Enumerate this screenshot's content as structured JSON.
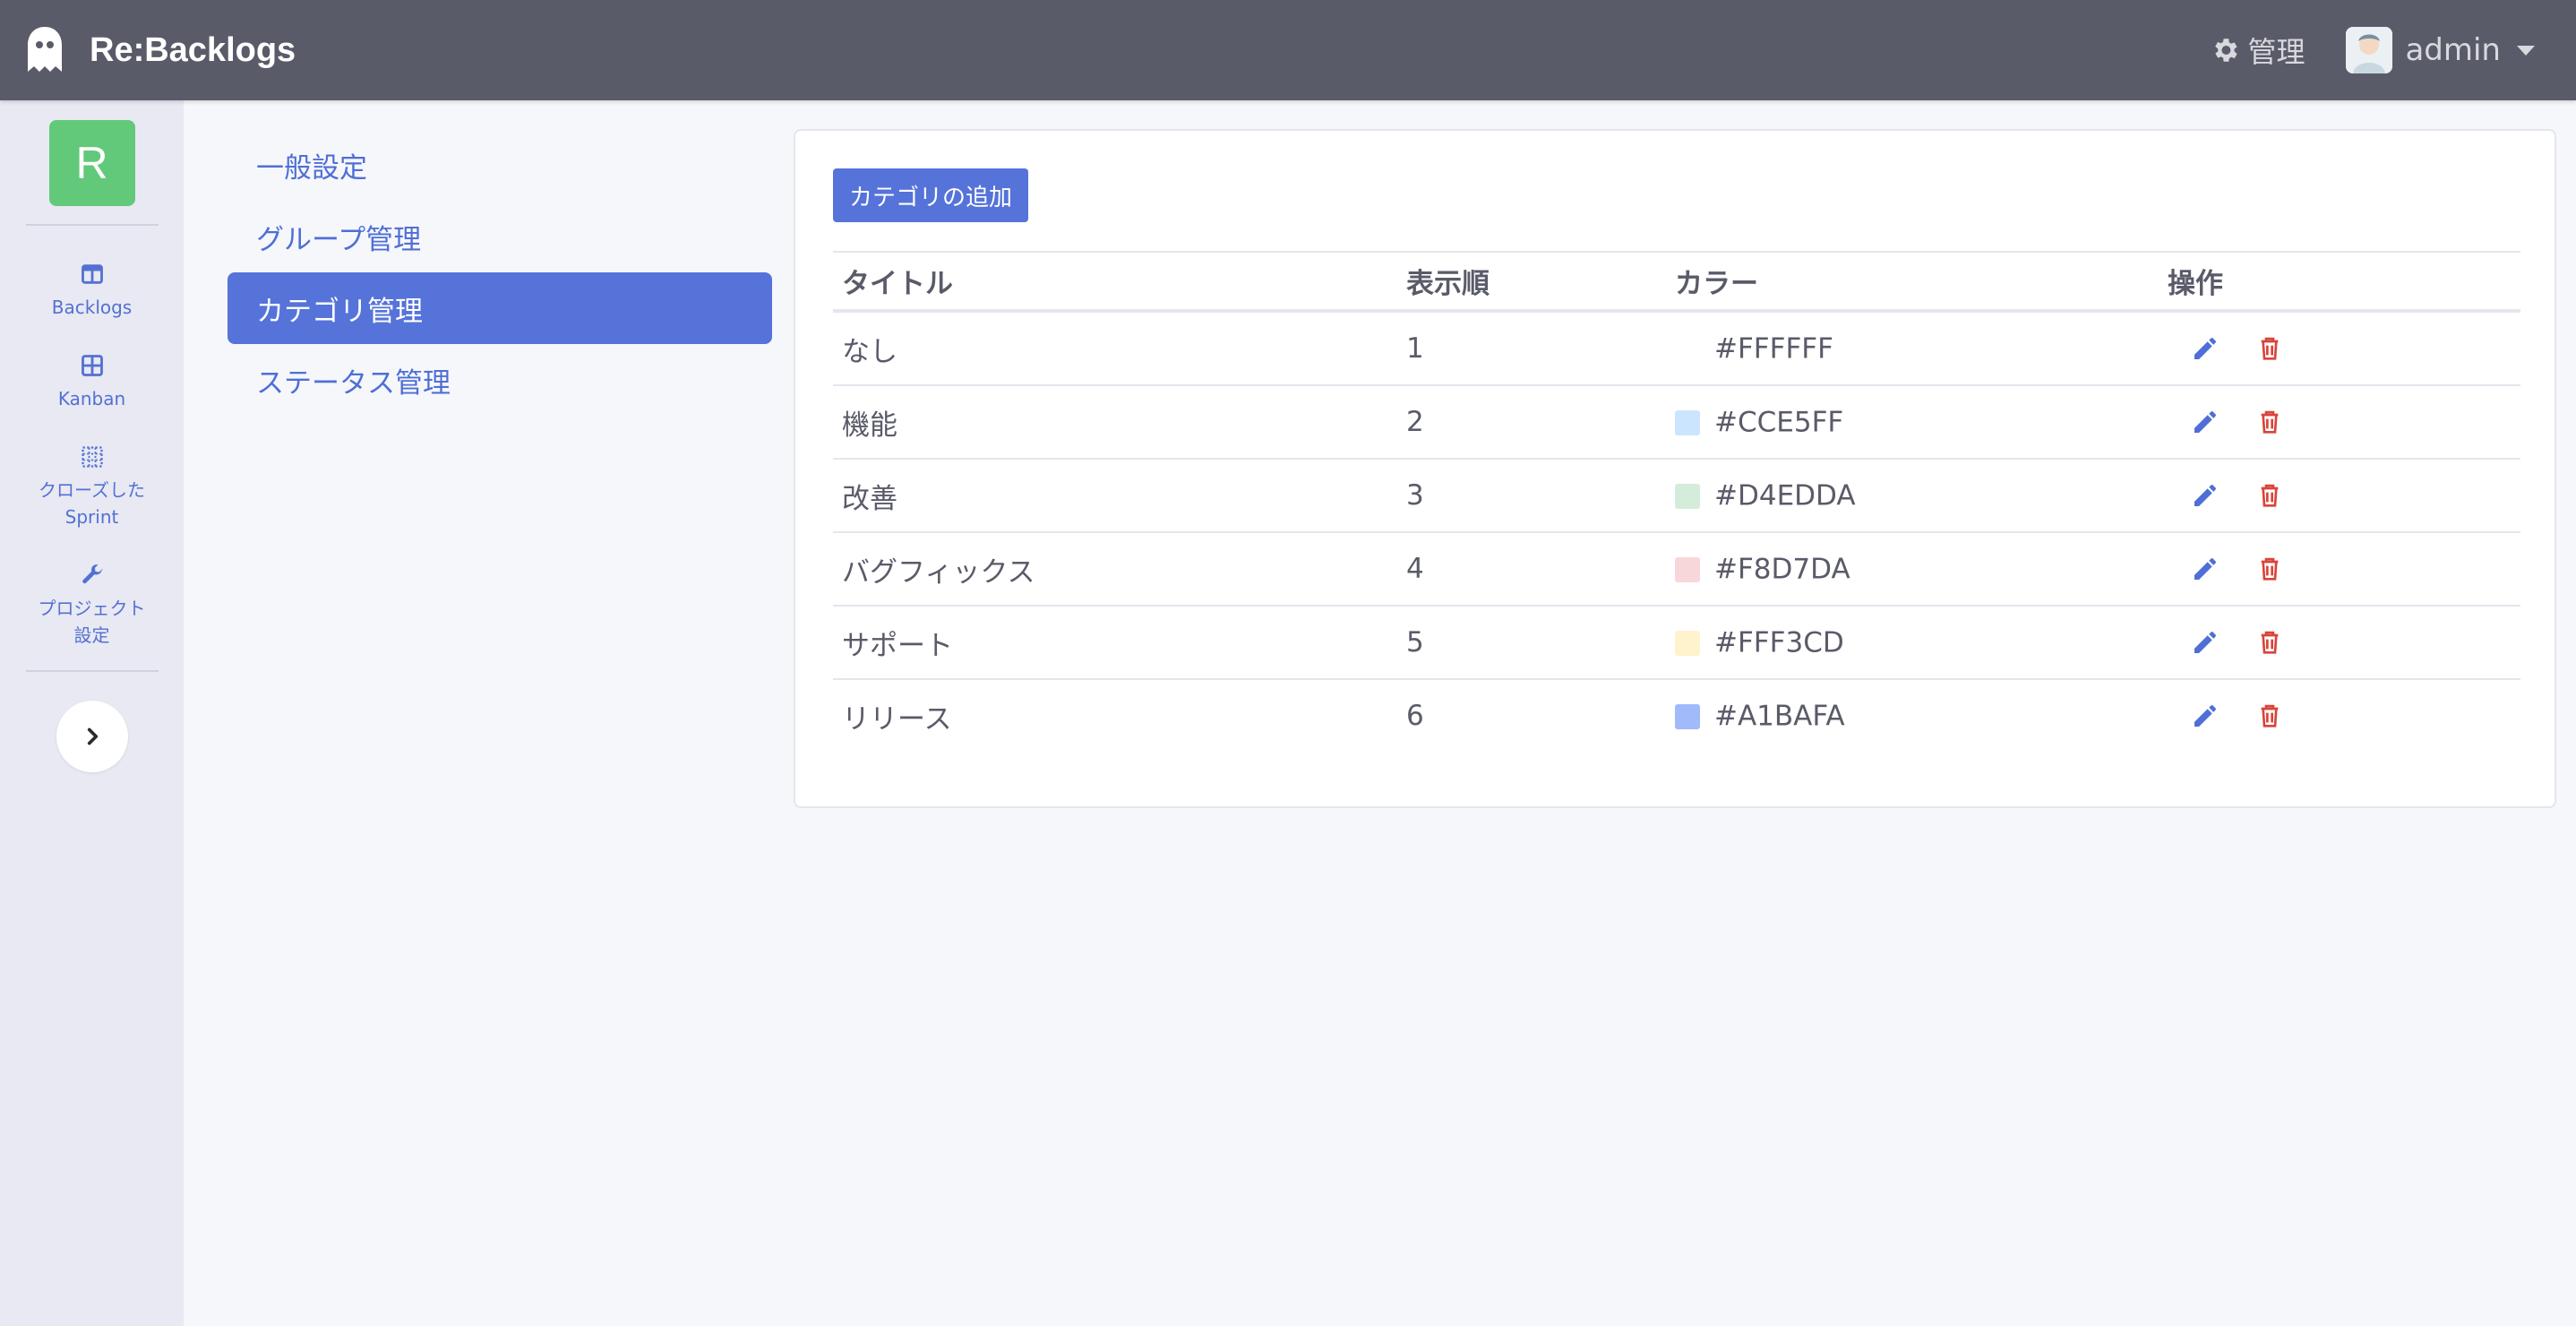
{
  "navbar": {
    "brand": "Re:Backlogs",
    "admin_link": "管理",
    "user_name": "admin"
  },
  "sidebar": {
    "project_initial": "R",
    "items": [
      {
        "label": "Backlogs",
        "icon": "backlog-icon"
      },
      {
        "label": "Kanban",
        "icon": "kanban-icon"
      },
      {
        "label": "クローズした\nSprint",
        "icon": "closed-sprint-icon"
      },
      {
        "label": "プロジェクト\n設定",
        "icon": "wrench-icon"
      }
    ],
    "toggle_icon": "chevron-right-icon"
  },
  "settings_menu": {
    "items": [
      {
        "label": "一般設定",
        "active": false
      },
      {
        "label": "グループ管理",
        "active": false
      },
      {
        "label": "カテゴリ管理",
        "active": true
      },
      {
        "label": "ステータス管理",
        "active": false
      }
    ]
  },
  "category_panel": {
    "add_button": "カテゴリの追加",
    "columns": [
      "タイトル",
      "表示順",
      "カラー",
      "操作"
    ],
    "rows": [
      {
        "title": "なし",
        "order": "1",
        "color": "#FFFFFF"
      },
      {
        "title": "機能",
        "order": "2",
        "color": "#CCE5FF"
      },
      {
        "title": "改善",
        "order": "3",
        "color": "#D4EDDA"
      },
      {
        "title": "バグフィックス",
        "order": "4",
        "color": "#F8D7DA"
      },
      {
        "title": "サポート",
        "order": "5",
        "color": "#FFF3CD"
      },
      {
        "title": "リリース",
        "order": "6",
        "color": "#A1BAFA"
      }
    ]
  },
  "colors": {
    "navbar_bg": "#5a5b69",
    "accent": "#5573d9",
    "project_badge": "#62c97a",
    "edit_icon": "#4f6fd6",
    "delete_icon": "#d9443a"
  }
}
